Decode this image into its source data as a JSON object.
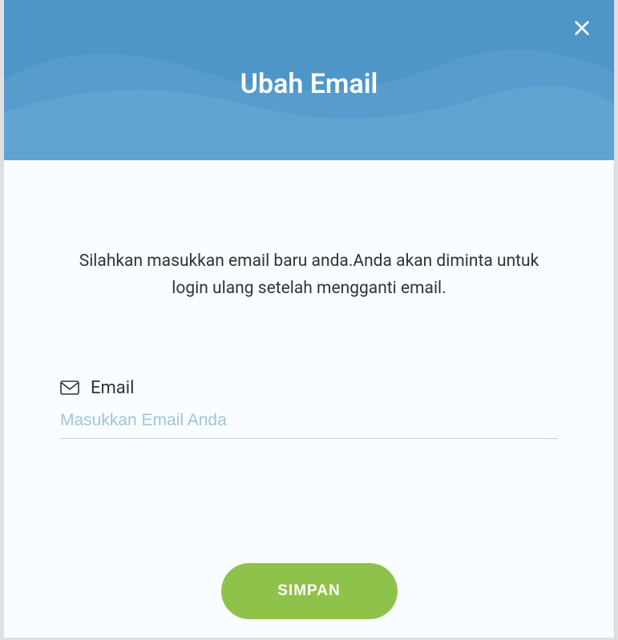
{
  "modal": {
    "title": "Ubah Email",
    "description": "Silahkan masukkan email baru anda.Anda akan diminta untuk login ulang setelah mengganti email.",
    "email_label": "Email",
    "email_placeholder": "Masukkan Email Anda",
    "email_value": "",
    "submit_label": "SIMPAN"
  },
  "colors": {
    "header_bg": "#4f96c8",
    "body_bg": "#fafdff",
    "submit_bg": "#8fc24a",
    "placeholder": "#9fc5de"
  }
}
